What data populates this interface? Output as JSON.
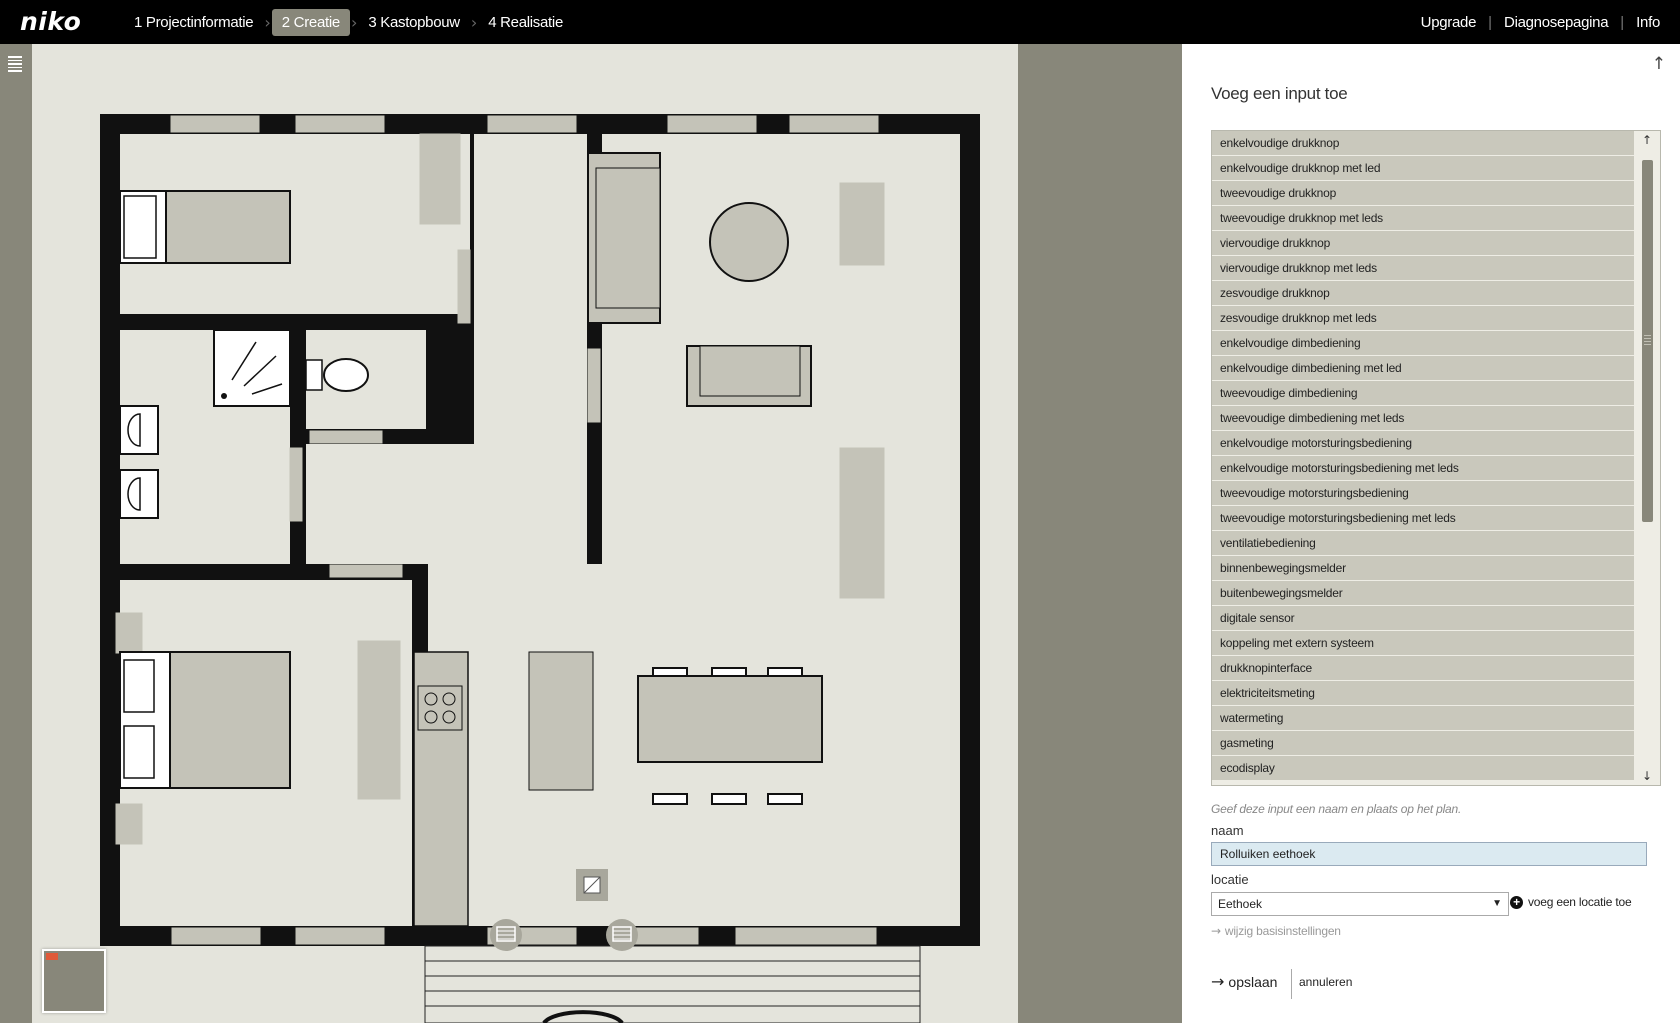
{
  "header": {
    "logo": "niko",
    "steps": [
      {
        "label": "1 Projectinformatie",
        "active": false
      },
      {
        "label": "2 Creatie",
        "active": true
      },
      {
        "label": "3 Kastopbouw",
        "active": false
      },
      {
        "label": "4 Realisatie",
        "active": false
      }
    ],
    "links": [
      "Upgrade",
      "Diagnosepagina",
      "Info"
    ],
    "separator": "|"
  },
  "icons": {
    "menu": "list-menu-icon",
    "scroll_top": "arrow-up-icon",
    "output_markers": "motor-shutter-icon",
    "input_marker": "pushbutton-input-icon"
  },
  "colors": {
    "topbar": "#000000",
    "accent": "#88877a",
    "list_item": "#c9c8bc",
    "input_focus": "#dbeaf1",
    "canvas": "#e4e4dc"
  },
  "panel": {
    "title": "Voeg een input toe",
    "input_types": [
      "enkelvoudige drukknop",
      "enkelvoudige drukknop met led",
      "tweevoudige drukknop",
      "tweevoudige drukknop met leds",
      "viervoudige drukknop",
      "viervoudige drukknop met leds",
      "zesvoudige drukknop",
      "zesvoudige drukknop met leds",
      "enkelvoudige dimbediening",
      "enkelvoudige dimbediening met led",
      "tweevoudige dimbediening",
      "tweevoudige dimbediening met leds",
      "enkelvoudige motorsturingsbediening",
      "enkelvoudige motorsturingsbediening met leds",
      "tweevoudige motorsturingsbediening",
      "tweevoudige motorsturingsbediening met leds",
      "ventilatiebediening",
      "binnenbewegingsmelder",
      "buitenbewegingsmelder",
      "digitale sensor",
      "koppeling met extern systeem",
      "drukknopinterface",
      "elektriciteitsmeting",
      "watermeting",
      "gasmeting",
      "ecodisplay"
    ],
    "hint": "Geef deze input een naam en plaats op het plan.",
    "naam_label": "naam",
    "naam_value": "Rolluiken eethoek",
    "locatie_label": "locatie",
    "locatie_value": "Eethoek",
    "add_location": "voeg een locatie toe",
    "settings_link": "wijzig basisinstellingen",
    "save": "opslaan",
    "cancel": "annuleren"
  }
}
